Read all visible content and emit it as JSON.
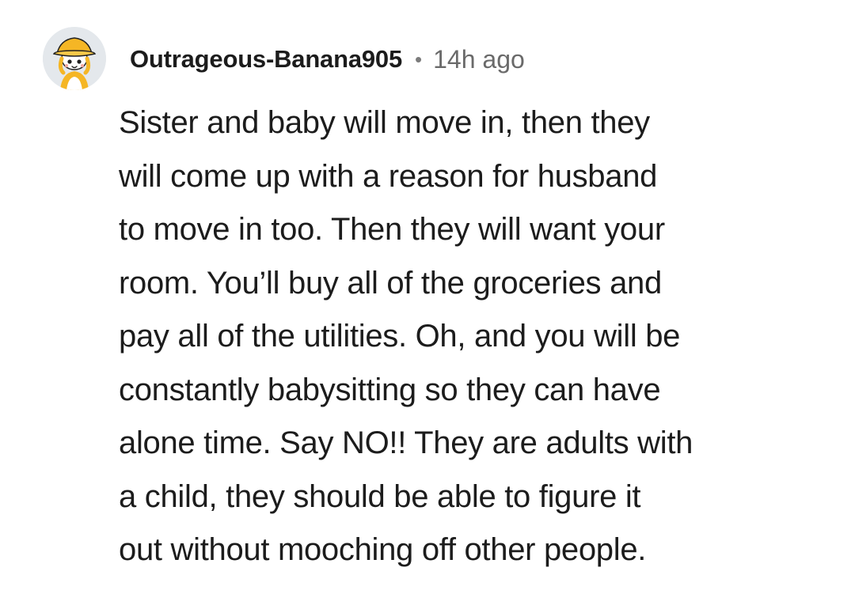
{
  "comment": {
    "author": {
      "username": "Outrageous-Banana905",
      "avatar_icon": "avatar-icon"
    },
    "separator": "•",
    "timestamp": "14h ago",
    "body_lines": [
      "Sister and baby will move in, then they",
      "will come up with a reason for husband",
      "to move in too. Then they will want your",
      "room. You’ll buy all of the groceries and",
      "pay all of the utilities. Oh, and you will be",
      "constantly babysitting so they can have",
      "alone time. Say NO!! They are adults with",
      "a child, they should be able to figure it",
      "out without mooching off other people."
    ]
  },
  "colors": {
    "background": "#ffffff",
    "text": "#1c1c1c",
    "meta": "#6a6a6a",
    "avatar_bg": "#e4e8ec",
    "avatar_hat": "#f5b625"
  }
}
